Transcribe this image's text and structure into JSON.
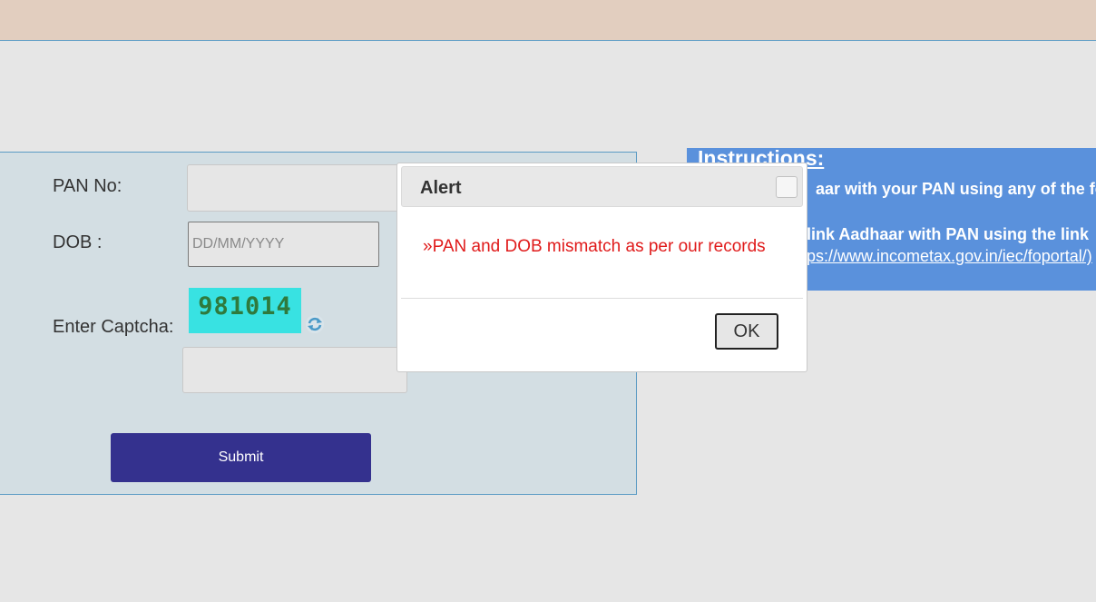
{
  "form": {
    "pan_label": "PAN No:",
    "pan_value": "",
    "dob_label": "DOB :",
    "dob_placeholder": "DD/MM/YYYY",
    "captcha_label": "Enter Captcha:",
    "captcha_code": "981014",
    "captcha_value": "",
    "submit_label": "Submit"
  },
  "instructions": {
    "title": "Instructions:",
    "line1": "aar with your PAN using any of the foll",
    "line2": "n link Aadhaar with PAN using the link",
    "link": "tps://www.incometax.gov.in/iec/foportal/)"
  },
  "alert": {
    "title": "Alert",
    "message": "»PAN and DOB mismatch as per our records",
    "ok_label": "OK"
  },
  "colors": {
    "header_band": "#e2cebf",
    "submit_button": "#34318e",
    "instructions_bg": "#5a91dc",
    "error_text": "#e01a1a",
    "captcha_bg": "#38e2e2"
  },
  "icons": {
    "captcha_refresh": "refresh-icon",
    "modal_close": "close-icon"
  }
}
